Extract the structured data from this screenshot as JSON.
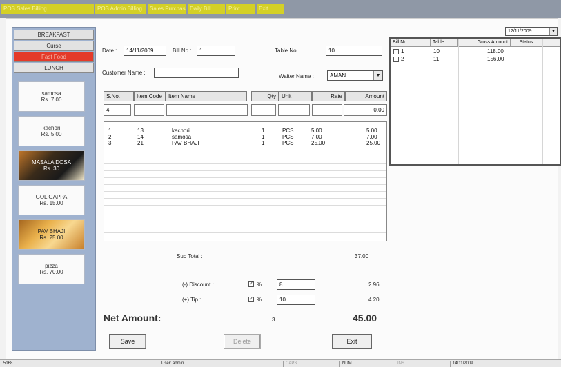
{
  "menubar": {
    "items": [
      "POS  Sales  Billing",
      "POS  Admin  Billing",
      "Sales  Purchase",
      "Daily  Bill",
      "Print",
      "Exit"
    ]
  },
  "categories": [
    {
      "label": "BREAKFAST",
      "active": false
    },
    {
      "label": "Curse",
      "active": false
    },
    {
      "label": "Fast Food",
      "active": true
    },
    {
      "label": "LUNCH",
      "active": false
    }
  ],
  "menu_items": [
    {
      "name": "samosa",
      "price": "Rs. 7.00",
      "style": "plain"
    },
    {
      "name": "kachori",
      "price": "Rs. 5.00",
      "style": "plain"
    },
    {
      "name": "MASALA DOSA",
      "price": "Rs. 30",
      "style": "photo-dark"
    },
    {
      "name": "GOL GAPPA",
      "price": "Rs. 15.00",
      "style": "plain"
    },
    {
      "name": "PAV BHAJI",
      "price": "Rs. 25.00",
      "style": "photo"
    },
    {
      "name": "pizza",
      "price": "Rs. 70.00",
      "style": "plain"
    }
  ],
  "form": {
    "date_label": "Date :",
    "date_value": "14/11/2009",
    "bill_no_label": "Bill No :",
    "bill_no_value": "1",
    "table_no_label": "Table No.",
    "table_no_value": "10",
    "customer_name_label": "Customer Name :",
    "customer_name_value": "",
    "waiter_name_label": "Waiter Name :",
    "waiter_name_value": "AMAN"
  },
  "item_columns": [
    "S.No.",
    "Item Code",
    "Item Name",
    "Qty",
    "Unit",
    "Rate",
    "Amount"
  ],
  "entry_row": {
    "sno": "4",
    "code": "",
    "name": "",
    "qty": "",
    "unit": "",
    "rate": "",
    "amount": "0.00"
  },
  "items": [
    {
      "sno": "1",
      "code": "13",
      "name": "kachori",
      "qty": "1",
      "unit": "PCS",
      "rate": "5.00",
      "amount": "5.00"
    },
    {
      "sno": "2",
      "code": "14",
      "name": "samosa",
      "qty": "1",
      "unit": "PCS",
      "rate": "7.00",
      "amount": "7.00"
    },
    {
      "sno": "3",
      "code": "21",
      "name": "PAV BHAJI",
      "qty": "1",
      "unit": "PCS",
      "rate": "25.00",
      "amount": "25.00"
    }
  ],
  "totals": {
    "subtotal_label": "Sub Total :",
    "subtotal_value": "37.00",
    "discount_label": "(-) Discount :",
    "discount_percent_sign": "%",
    "discount_rate": "8",
    "discount_value": "2.96",
    "tip_label": "(+) Tip :",
    "tip_percent_sign": "%",
    "tip_rate": "10",
    "tip_value": "4.20",
    "net_label": "Net Amount:",
    "net_qty": "3",
    "net_value": "45.00"
  },
  "buttons": {
    "save": "Save",
    "delete": "Delete",
    "exit": "Exit"
  },
  "bills_panel": {
    "date_select": "12/11/2009",
    "columns": [
      "Bill No",
      "Table",
      "Gross Amount",
      "Status"
    ],
    "rows": [
      {
        "bill": "1",
        "table": "10",
        "amount": "118.00",
        "status": ""
      },
      {
        "bill": "2",
        "table": "11",
        "amount": "156.00",
        "status": ""
      }
    ]
  },
  "statusbar": {
    "cells": [
      "5168",
      "User: admin",
      "CAPS",
      "NUM",
      "INS",
      "14/11/2009"
    ]
  }
}
